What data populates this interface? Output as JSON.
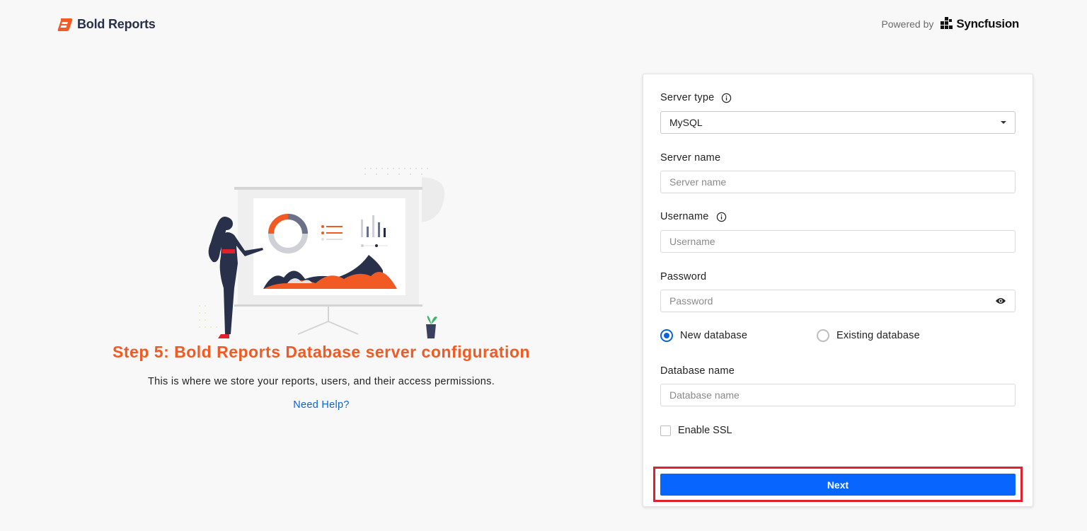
{
  "brand": {
    "name": "Bold Reports",
    "accent": "#f15a22"
  },
  "powered_by": {
    "label": "Powered by",
    "company": "Syncfusion"
  },
  "step": {
    "title": "Step 5: Bold Reports Database server configuration",
    "description": "This is where we store your reports, users, and their access permissions.",
    "help_link": "Need Help?"
  },
  "form": {
    "server_type": {
      "label": "Server type",
      "value": "MySQL"
    },
    "server_name": {
      "label": "Server name",
      "placeholder": "Server name"
    },
    "username": {
      "label": "Username",
      "placeholder": "Username"
    },
    "password": {
      "label": "Password",
      "placeholder": "Password"
    },
    "database_mode": {
      "options": [
        "New database",
        "Existing database"
      ],
      "selected": "New database"
    },
    "database_name": {
      "label": "Database name",
      "placeholder": "Database name"
    },
    "enable_ssl": {
      "label": "Enable SSL",
      "checked": false
    },
    "next_button": "Next"
  },
  "colors": {
    "primary": "#0866ff",
    "link": "#0b63d6",
    "highlight": "#e0202a"
  }
}
